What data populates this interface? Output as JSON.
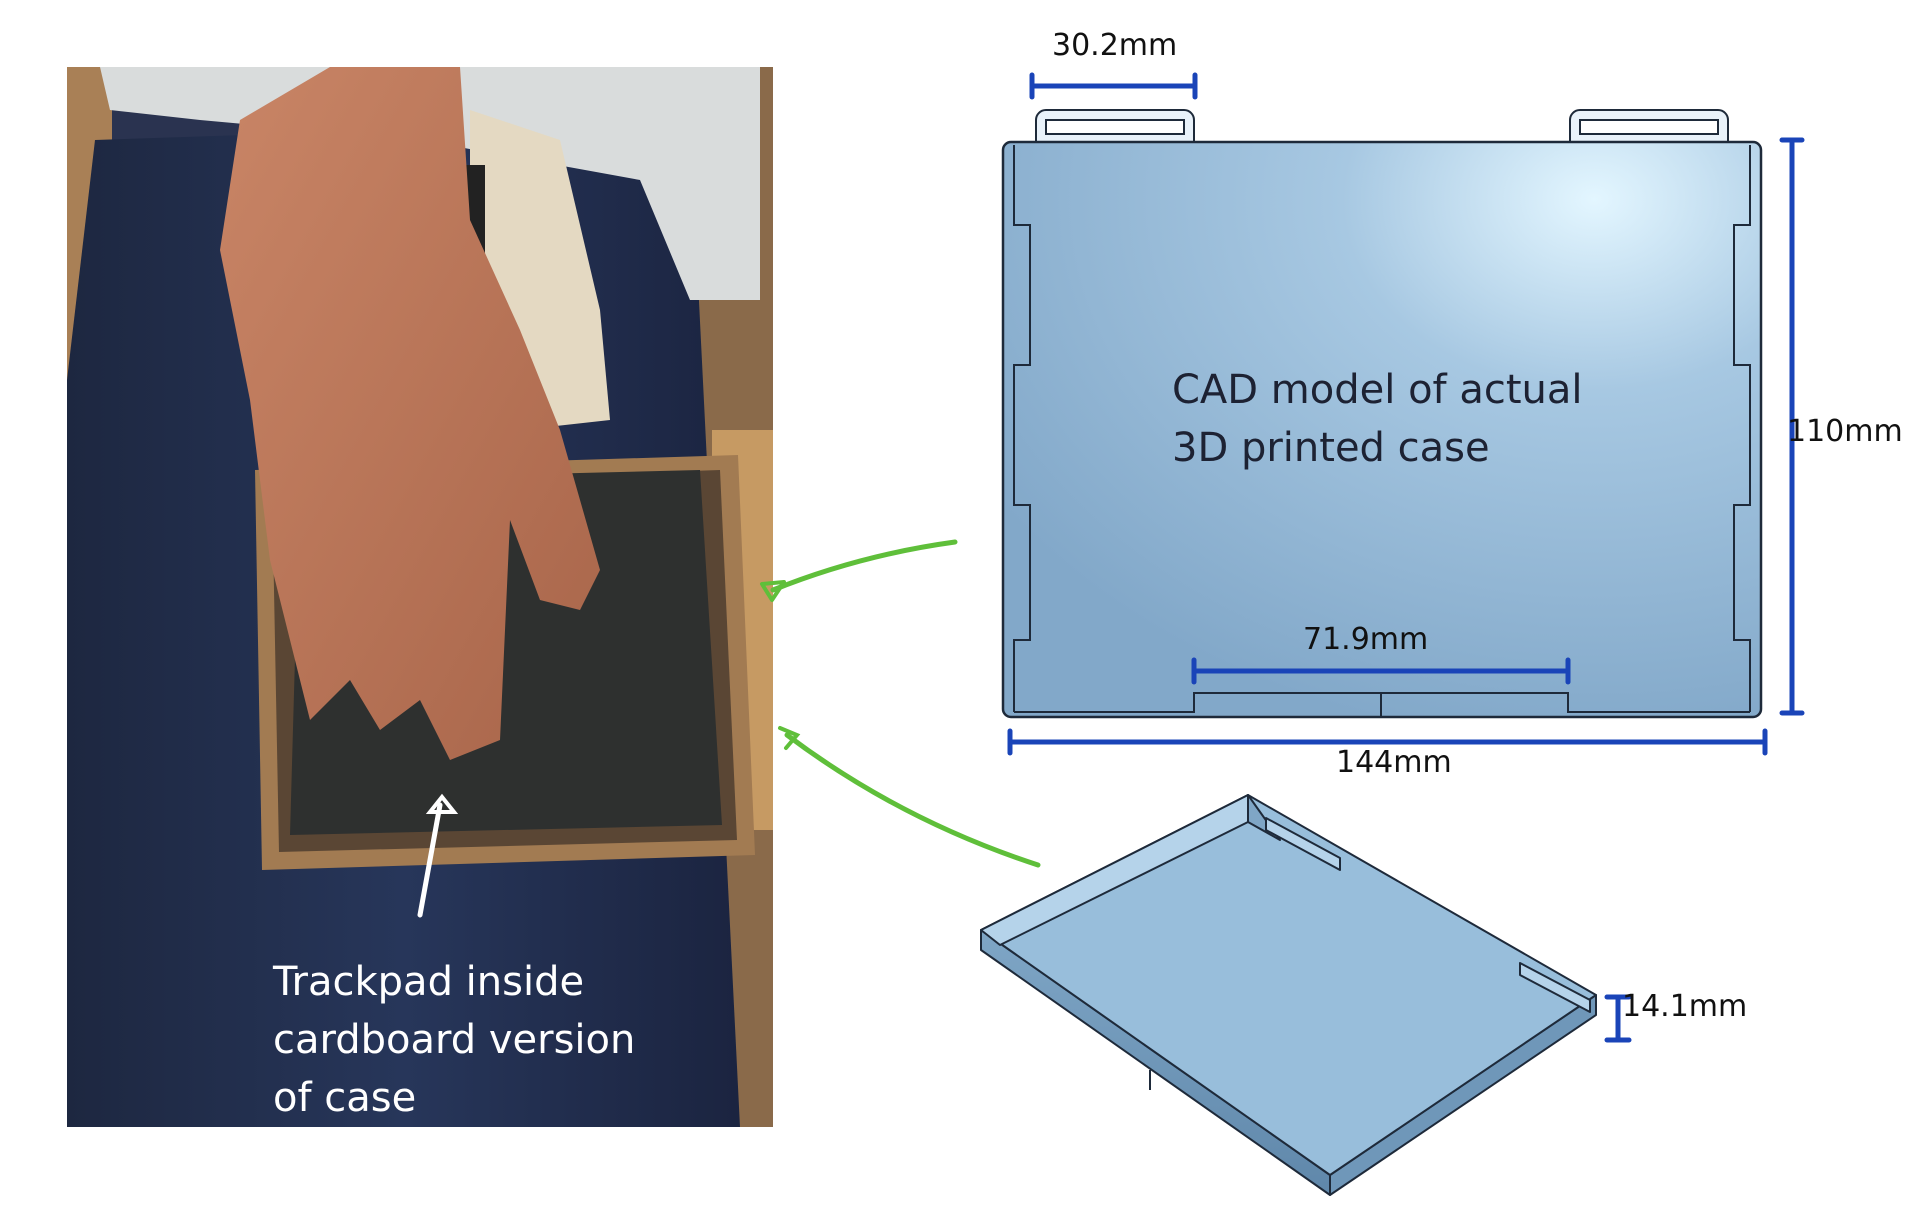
{
  "photo": {
    "caption": [
      "Trackpad inside",
      "cardboard version",
      "of case"
    ]
  },
  "cad_top_view": {
    "caption": [
      "CAD model of actual",
      "3D printed case"
    ],
    "dimensions": {
      "tab_width": "30.2mm",
      "height": "110mm",
      "bottom_cutout": "71.9mm",
      "width": "144mm"
    }
  },
  "cad_iso_view": {
    "dimensions": {
      "depth": "14.1mm"
    }
  },
  "colors": {
    "annotation_blue": "#1a44b8",
    "arrow_green": "#5fbf3a",
    "case_blue": "#8fb3d2",
    "case_outline": "#1e2a3a"
  }
}
